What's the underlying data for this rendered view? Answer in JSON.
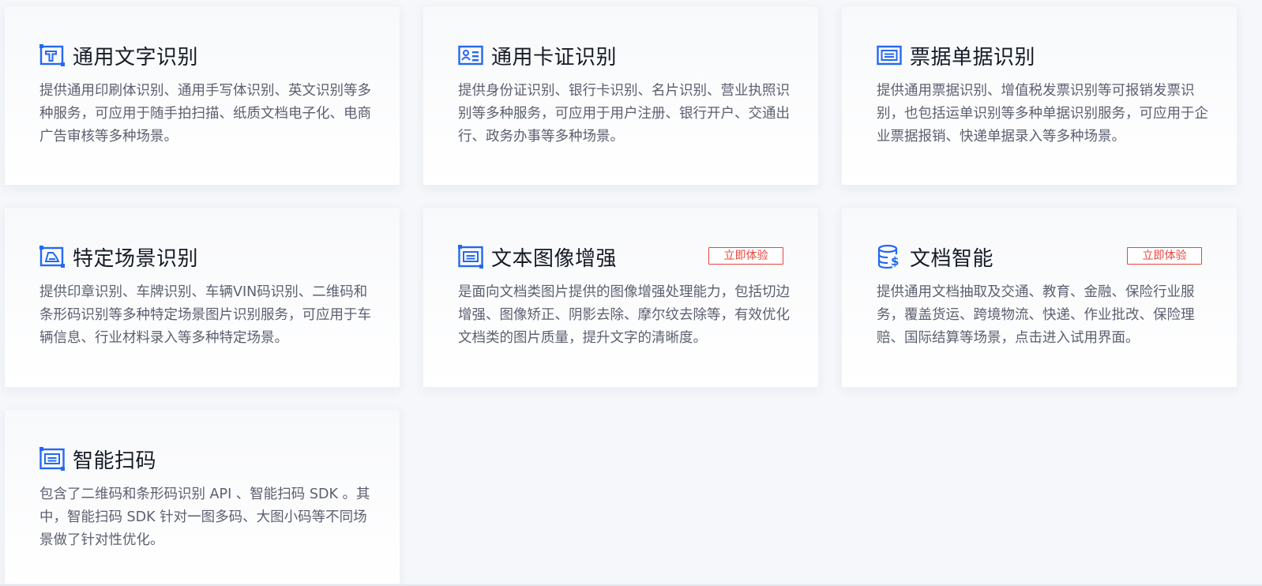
{
  "cards": [
    {
      "title": "通用文字识别",
      "icon": "text-ocr-icon",
      "desc": "提供通用印刷体识别、通用手写体识别、英文识别等多种服务，可应用于随手拍扫描、纸质文档电子化、电商广告审核等多种场景。"
    },
    {
      "title": "通用卡证识别",
      "icon": "id-card-icon",
      "desc": "提供身份证识别、银行卡识别、名片识别、营业执照识别等多种服务，可应用于用户注册、银行开户、交通出行、政务办事等多种场景。"
    },
    {
      "title": "票据单据识别",
      "icon": "receipt-icon",
      "desc": "提供通用票据识别、增值税发票识别等可报销发票识别，也包括运单识别等多种单据识别服务，可应用于企业票据报销、快递单据录入等多种场景。"
    },
    {
      "title": "特定场景识别",
      "icon": "scene-icon",
      "desc": "提供印章识别、车牌识别、车辆VIN码识别、二维码和条形码识别等多种特定场景图片识别服务，可应用于车辆信息、行业材料录入等多种特定场景。"
    },
    {
      "title": "文本图像增强",
      "icon": "image-enhance-icon",
      "button": "立即体验",
      "desc": "是面向文档类图片提供的图像增强处理能力，包括切边增强、图像矫正、阴影去除、摩尔纹去除等，有效优化文档类的图片质量，提升文字的清晰度。"
    },
    {
      "title": "文档智能",
      "icon": "document-intelligence-icon",
      "button": "立即体验",
      "desc": "提供通用文档抽取及交通、教育、金融、保险行业服务，覆盖货运、跨境物流、快递、作业批改、保险理赔、国际结算等场景，点击进入试用界面。"
    },
    {
      "title": "智能扫码",
      "icon": "qr-scan-icon",
      "desc": "包含了二维码和条形码识别 API 、智能扫码 SDK 。其中，智能扫码 SDK 针对一图多码、大图小码等不同场景做了针对性优化。"
    }
  ],
  "colors": {
    "accent": "#2468f2",
    "button_red": "#e8453c",
    "title": "#151b26",
    "desc": "#5c6070",
    "background": "#f5f7fa"
  }
}
